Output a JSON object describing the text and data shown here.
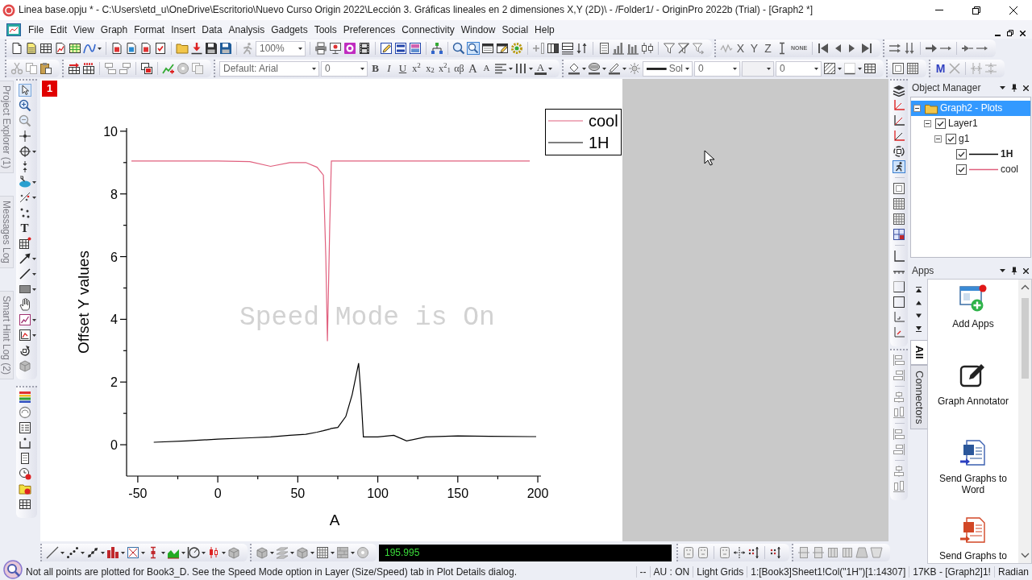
{
  "window": {
    "title": "Linea base.opju * - C:\\Users\\etd_u\\OneDrive\\Escritorio\\Nuevo Curso Origin 2022\\Lección 3. Gráficas lineales en 2 dimensiones X,Y (2D)\\ - /Folder1/ - OriginPro 2022b (Trial) - [Graph2 *]"
  },
  "menu": [
    "File",
    "Edit",
    "View",
    "Graph",
    "Format",
    "Insert",
    "Data",
    "Analysis",
    "Gadgets",
    "Tools",
    "Preferences",
    "Connectivity",
    "Window",
    "Social",
    "Help"
  ],
  "standard_toolbar": {
    "zoom_combo": "100%"
  },
  "mask_toolbar": {
    "axis_buttons": [
      "X",
      "Y",
      "Z"
    ],
    "none_button": "NONE"
  },
  "format_toolbar": {
    "font_combo": "Default: Arial",
    "size_combo": "0",
    "style_buttons": [
      "B",
      "I",
      "U"
    ],
    "script_buttons": [
      "x$^{2}$",
      "x$_{2}$",
      "x$^{2}$$_{1}$"
    ],
    "greek_button": "αβ",
    "font_size_buttons": [
      "A",
      "A"
    ],
    "font_color_button": "A",
    "line_style_combo": "Sol",
    "number_combos": [
      "0",
      "0"
    ],
    "math_button": "M"
  },
  "tools_toolbar": {
    "text_tool": "T"
  },
  "side_tabs": [
    "Project Explorer (1)",
    "Messages Log",
    "Smart Hint Log (2)"
  ],
  "graph": {
    "layer_badge": "1",
    "speed_mode_notice": "Speed Mode is On",
    "chart_data": {
      "type": "line",
      "xlabel": "A",
      "ylabel": "Offset Y values",
      "x": [
        -54,
        -40,
        -20,
        0,
        20,
        33,
        45,
        55,
        62,
        66,
        67.5,
        68.5,
        70,
        71,
        75,
        80,
        84,
        86,
        88,
        89.5,
        91,
        100,
        110,
        118,
        130,
        150,
        170,
        195,
        199
      ],
      "series": [
        {
          "name": "cool",
          "color": "#e0607e",
          "values": [
            9.05,
            9.05,
            9.05,
            9.05,
            9.03,
            8.88,
            9.0,
            9.0,
            8.85,
            8.6,
            6.0,
            3.3,
            7.0,
            9.05,
            9.05,
            9.05,
            9.05,
            9.05,
            9.05,
            9.05,
            9.05,
            9.05,
            9.05,
            9.05,
            9.05,
            9.05,
            9.05,
            9.05,
            null
          ]
        },
        {
          "name": "1H",
          "color": "#000000",
          "values": [
            null,
            0.08,
            0.12,
            0.18,
            0.22,
            0.25,
            0.3,
            0.33,
            0.4,
            0.45,
            0.47,
            0.48,
            0.5,
            0.52,
            0.55,
            0.9,
            1.6,
            2.1,
            2.6,
            1.6,
            0.25,
            0.25,
            0.3,
            0.12,
            0.25,
            0.28,
            0.27,
            0.26,
            0.26
          ]
        }
      ],
      "xlim": [
        -57,
        202
      ],
      "ylim": [
        -1,
        10.1
      ],
      "xticks": [
        {
          "value": -50,
          "label": "-50"
        },
        {
          "value": 0,
          "label": "0"
        },
        {
          "value": 50,
          "label": "50"
        },
        {
          "value": 100,
          "label": "100"
        },
        {
          "value": 150,
          "label": "150"
        },
        {
          "value": 200,
          "label": "200"
        }
      ],
      "yticks": [
        {
          "value": 0,
          "label": "0"
        },
        {
          "value": 2,
          "label": "2"
        },
        {
          "value": 4,
          "label": "4"
        },
        {
          "value": 6,
          "label": "6"
        },
        {
          "value": 8,
          "label": "8"
        },
        {
          "value": 10,
          "label": "10"
        }
      ],
      "legend": "upper right"
    }
  },
  "coordinate_display": "195.995",
  "object_manager": {
    "title": "Object Manager",
    "tree": [
      {
        "label": "Graph2 - Plots",
        "selected": true,
        "expanded": true,
        "children": [
          {
            "label": "Layer1",
            "selected": false,
            "checked": true,
            "expanded": true,
            "children": [
              {
                "label": "g1",
                "selected": false,
                "checked": true,
                "expanded": true,
                "children": [
                  {
                    "label": "1H",
                    "selected": false,
                    "checked": true,
                    "active": true,
                    "color": "#000000"
                  },
                  {
                    "label": "cool",
                    "selected": false,
                    "checked": true,
                    "active": false,
                    "color": "#e0607e"
                  }
                ]
              }
            ]
          }
        ]
      }
    ]
  },
  "apps": {
    "title": "Apps",
    "tabs": [
      {
        "label": "All",
        "selected": true
      },
      {
        "label": "Connectors",
        "selected": false
      }
    ],
    "items": [
      {
        "kind": "add",
        "label": "Add Apps"
      },
      {
        "kind": "annotate",
        "label": "Graph Annotator"
      },
      {
        "kind": "word_export",
        "label": "Send Graphs to Word"
      },
      {
        "kind": "slides_export",
        "label": "Send Graphs to"
      }
    ]
  },
  "status_bar": {
    "message": "Not all points are plotted for Book3_D. See the Speed Mode option in Layer (Size/Speed) tab in Plot Details dialog.",
    "fields": [
      "--",
      "AU : ON",
      "Light Grids",
      "1:[Book3]Sheet1!Col(\"1H\")[1:14307]",
      "17KB - [Graph2]1!",
      "Radian"
    ]
  }
}
